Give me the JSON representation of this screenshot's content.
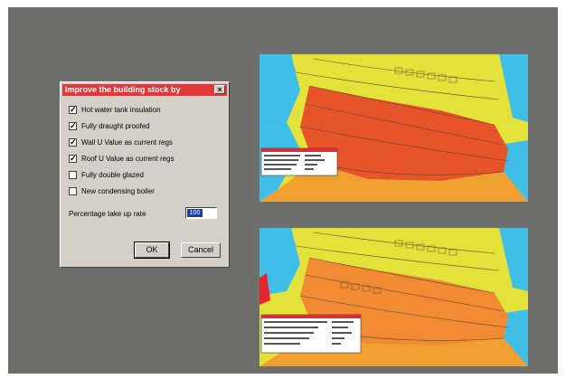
{
  "dialog": {
    "title": "Improve the building stock by",
    "close_glyph": "×",
    "options": [
      {
        "label": "Hot water tank insulation",
        "checked": true
      },
      {
        "label": "Fully draught proofed",
        "checked": true
      },
      {
        "label": "Wall U Value as current regs",
        "checked": true
      },
      {
        "label": "Roof U Value as current regs",
        "checked": true
      },
      {
        "label": "Fully double glazed",
        "checked": false
      },
      {
        "label": "New condensing boiler",
        "checked": false
      }
    ],
    "rate_label": "Percentage take up rate",
    "rate_value": "100",
    "ok_label": "OK",
    "cancel_label": "Cancel"
  },
  "colors": {
    "background": "#6e6e6c",
    "yellow": "#e3e23a",
    "orange": "#f0a030",
    "red": "#e8542a",
    "cyan": "#3fbfe8",
    "titlebar": "#e2383a"
  },
  "maps": [
    {
      "name": "map-before",
      "highlight_color": "#e8542a"
    },
    {
      "name": "map-after",
      "highlight_color": "#f08a33"
    }
  ]
}
